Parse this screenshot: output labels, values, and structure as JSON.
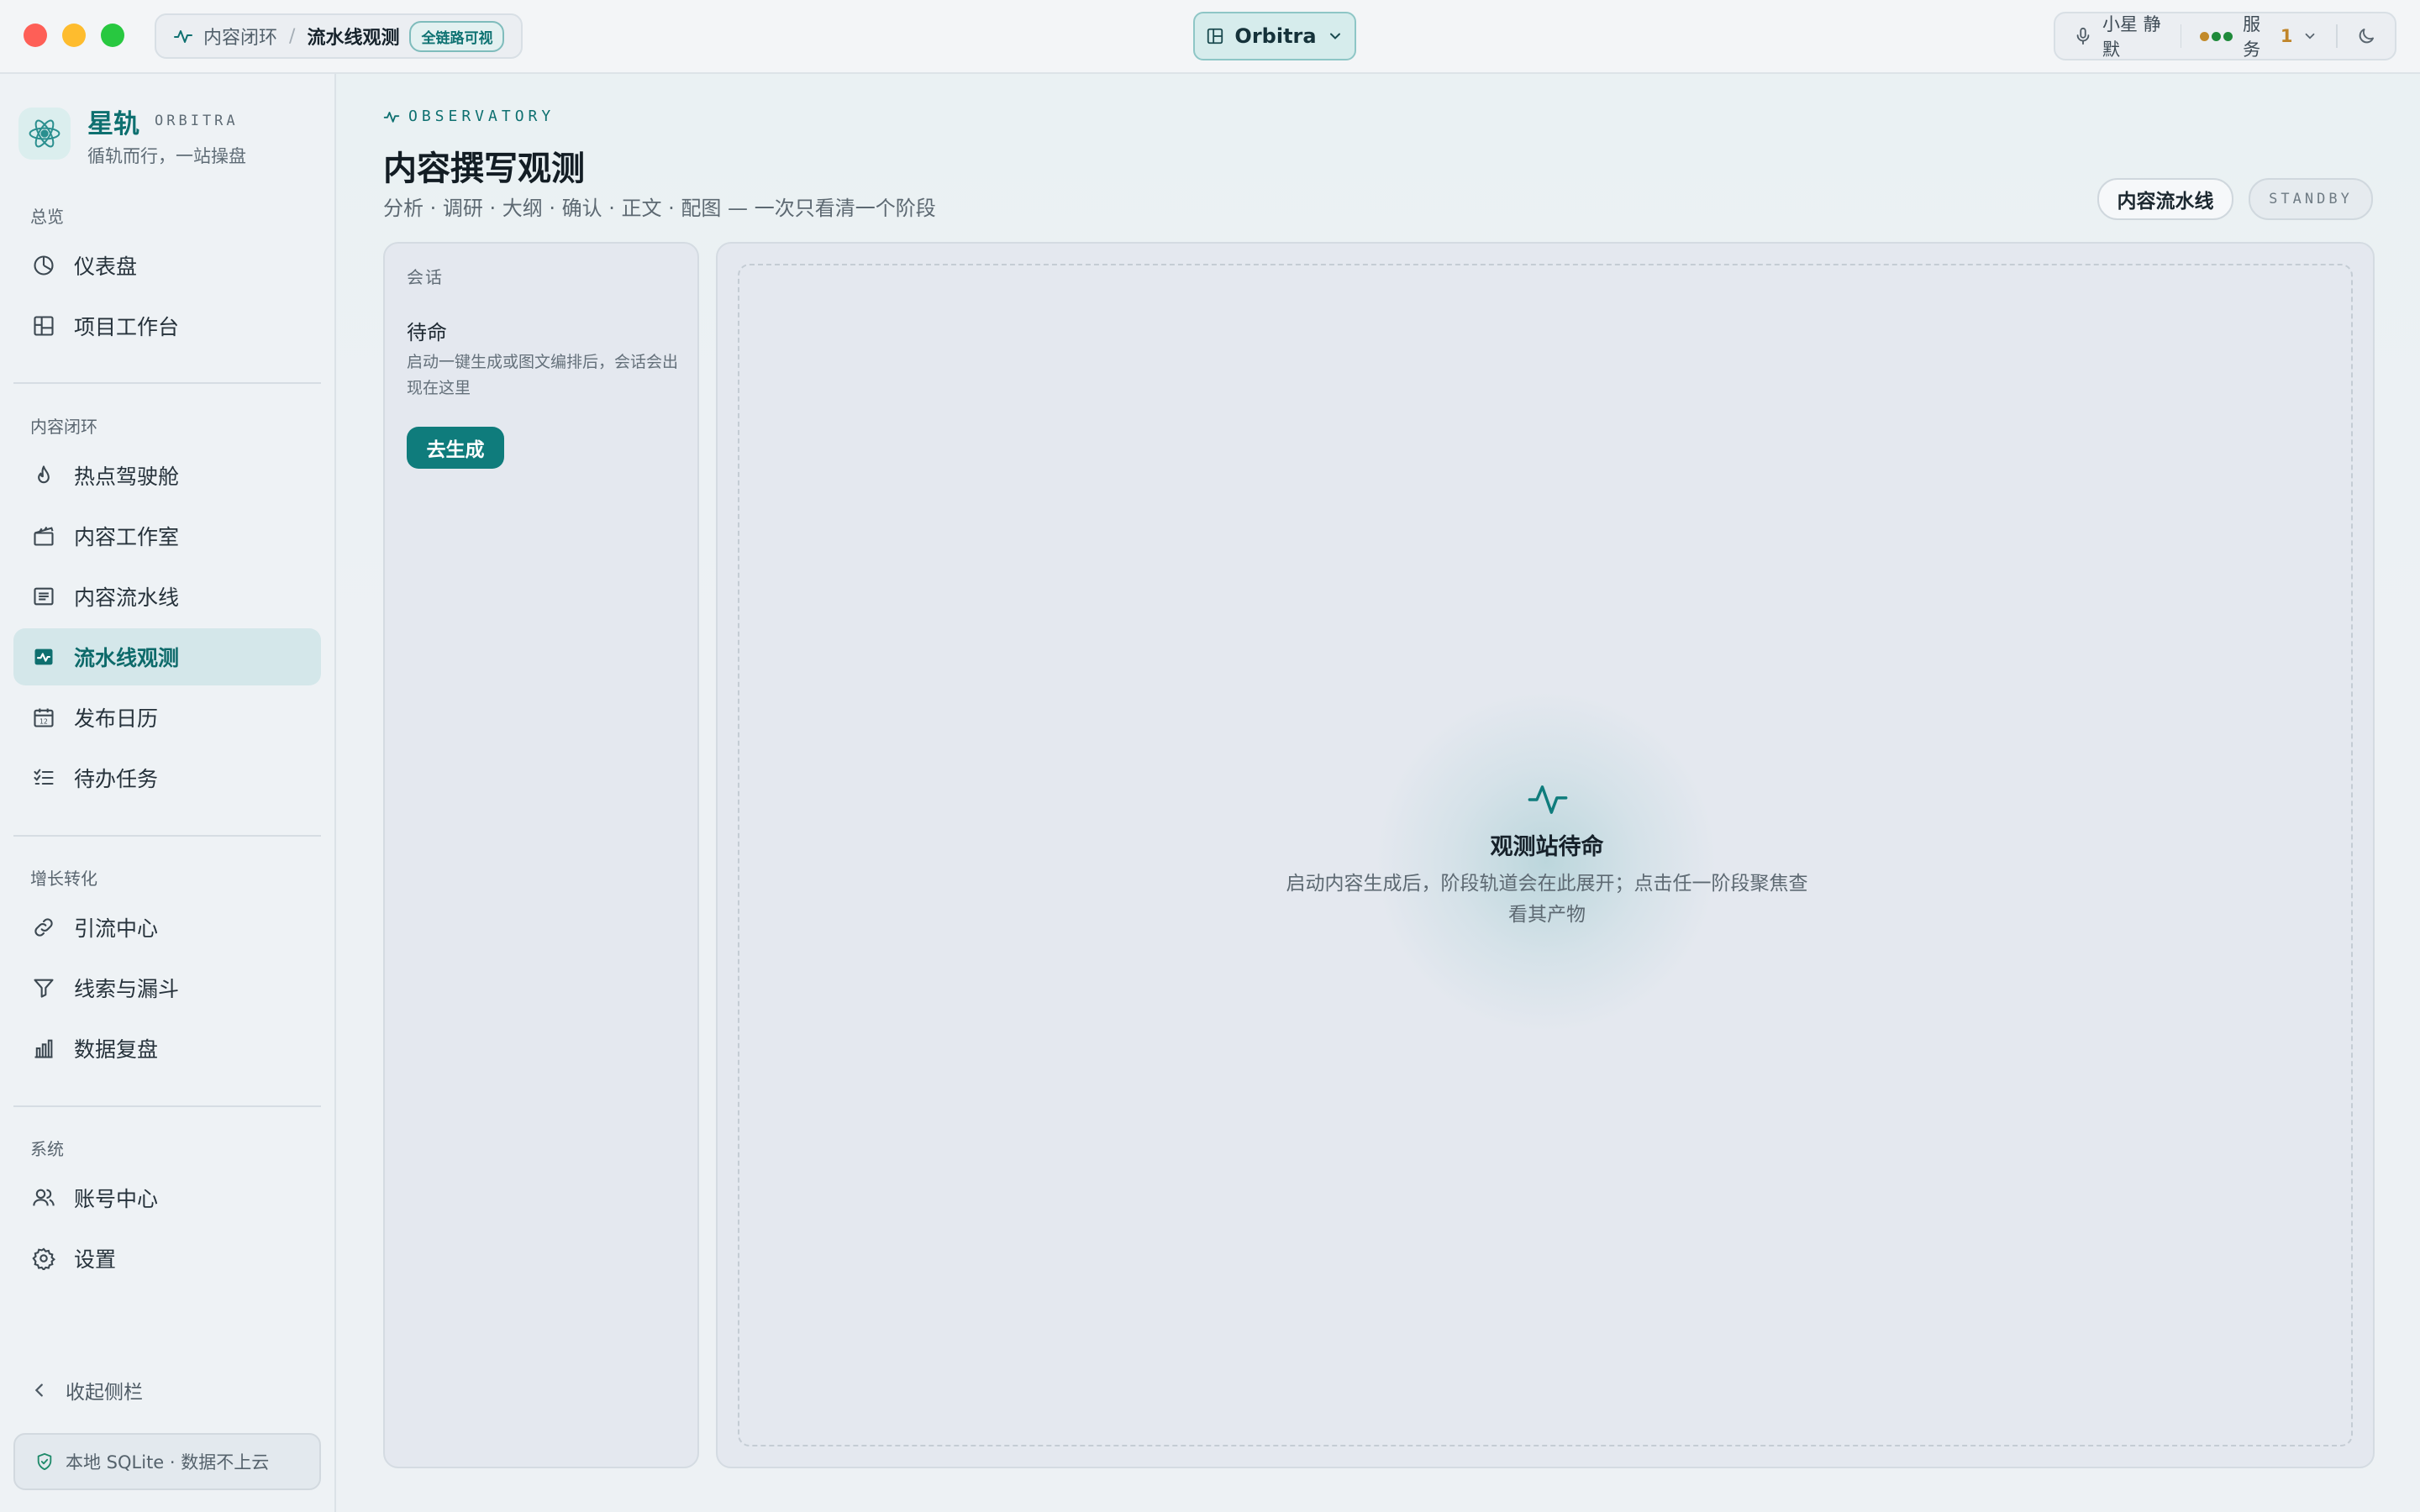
{
  "titlebar": {
    "breadcrumb_parent": "内容闭环",
    "breadcrumb_current": "流水线观测",
    "breadcrumb_tag": "全链路可视",
    "workspace": "Orbitra",
    "voice_label": "小星 静默",
    "service_label": "服务",
    "service_count": "1",
    "service_dot_colors": [
      "#c28a2a",
      "#1f8a3b",
      "#1f8a3b"
    ]
  },
  "sidebar": {
    "brand_name": "星轨",
    "brand_en": "ORBITRA",
    "slogan": "循轨而行，一站操盘",
    "sections": {
      "overview": "总览",
      "content_loop": "内容闭环",
      "growth": "增长转化",
      "system": "系统"
    },
    "items": {
      "dashboard": "仪表盘",
      "workbench": "项目工作台",
      "hotspot": "热点驾驶舱",
      "studio": "内容工作室",
      "pipeline": "内容流水线",
      "observatory": "流水线观测",
      "calendar": "发布日历",
      "todo": "待办任务",
      "traffic": "引流中心",
      "leads": "线索与漏斗",
      "review": "数据复盘",
      "accounts": "账号中心",
      "settings": "设置"
    },
    "active_item": "流水线观测",
    "collapse": "收起侧栏",
    "storage_note": "本地 SQLite · 数据不上云"
  },
  "main": {
    "eyebrow": "OBSERVATORY",
    "title": "内容撰写观测",
    "subtitle": "分析 · 调研 · 大纲 · 确认 · 正文 · 配图 — 一次只看清一个阶段",
    "pipeline_button": "内容流水线",
    "status_badge": "STANDBY",
    "session": {
      "label": "会话",
      "state": "待命",
      "description": "启动一键生成或图文编排后，会话会出现在这里",
      "action": "去生成"
    },
    "stage": {
      "title": "观测站待命",
      "description": "启动内容生成后，阶段轨道会在此展开；点击任一阶段聚焦查看其产物"
    }
  },
  "colors": {
    "accent": "#0f7c7c",
    "active_nav_bg": "#d4e7ea"
  }
}
